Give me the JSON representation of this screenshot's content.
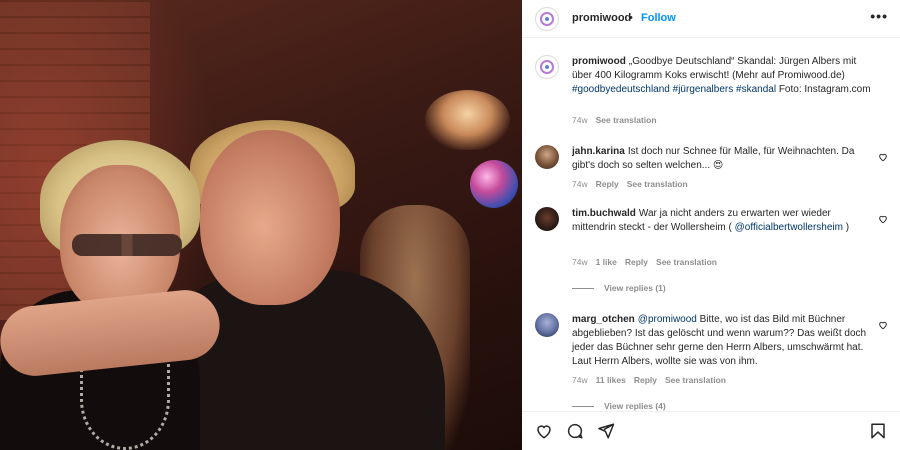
{
  "header": {
    "username": "promiwood",
    "dot": "•",
    "follow_label": "Follow",
    "more_icon": "more-horizontal-icon",
    "more_label": "•••"
  },
  "caption": {
    "username": "promiwood",
    "text": "„Goodbye Deutschland“ Skandal: Jürgen Albers mit über 400 Kilogramm Koks erwischt! (Mehr auf Promiwood.de) ",
    "hashtags": "#goodbyedeutschland #jürgenalbers #skandal",
    "text_after": " Foto: Instagram.com",
    "time": "74w",
    "translate": "See translation"
  },
  "comments": [
    {
      "username": "jahn.karina",
      "text": "Ist doch nur Schnee für Malle, für Weihnachten. Da gibt's doch so selten welchen...",
      "emoji": "😍",
      "time": "74w",
      "likes": "",
      "reply": "Reply",
      "translate": "See translation"
    },
    {
      "username": "tim.buchwald",
      "text_before": "War ja nicht anders zu erwarten wer wieder mittendrin steckt - der Wollersheim ( ",
      "mention": "@officialbertwollersheim",
      "text_after": " )",
      "time": "74w",
      "likes": "1 like",
      "reply": "Reply",
      "translate": "See translation",
      "view_replies": "View replies (1)"
    },
    {
      "username": "marg_otchen",
      "mention": "@promiwood",
      "text": " Bitte, wo ist das Bild mit Büchner abgeblieben? Ist das gelöscht und wenn warum?? Das weißt doch jeder das Büchner sehr gerne den Herrn Albers, umschwärmt hat. Laut Herrn Albers, wollte sie was von ihm.",
      "time": "74w",
      "likes": "11 likes",
      "reply": "Reply",
      "translate": "See translation",
      "view_replies": "View replies (4)"
    }
  ],
  "icons": {
    "like": "heart-icon",
    "comment": "comment-icon",
    "share": "send-icon",
    "save": "bookmark-icon",
    "comment_like": "small-heart-icon"
  },
  "colors": {
    "link_blue": "#0095f6",
    "hashtag": "#00376b",
    "secondary_text": "#8e8e8e",
    "avatar_ring": "#b77bd6"
  }
}
